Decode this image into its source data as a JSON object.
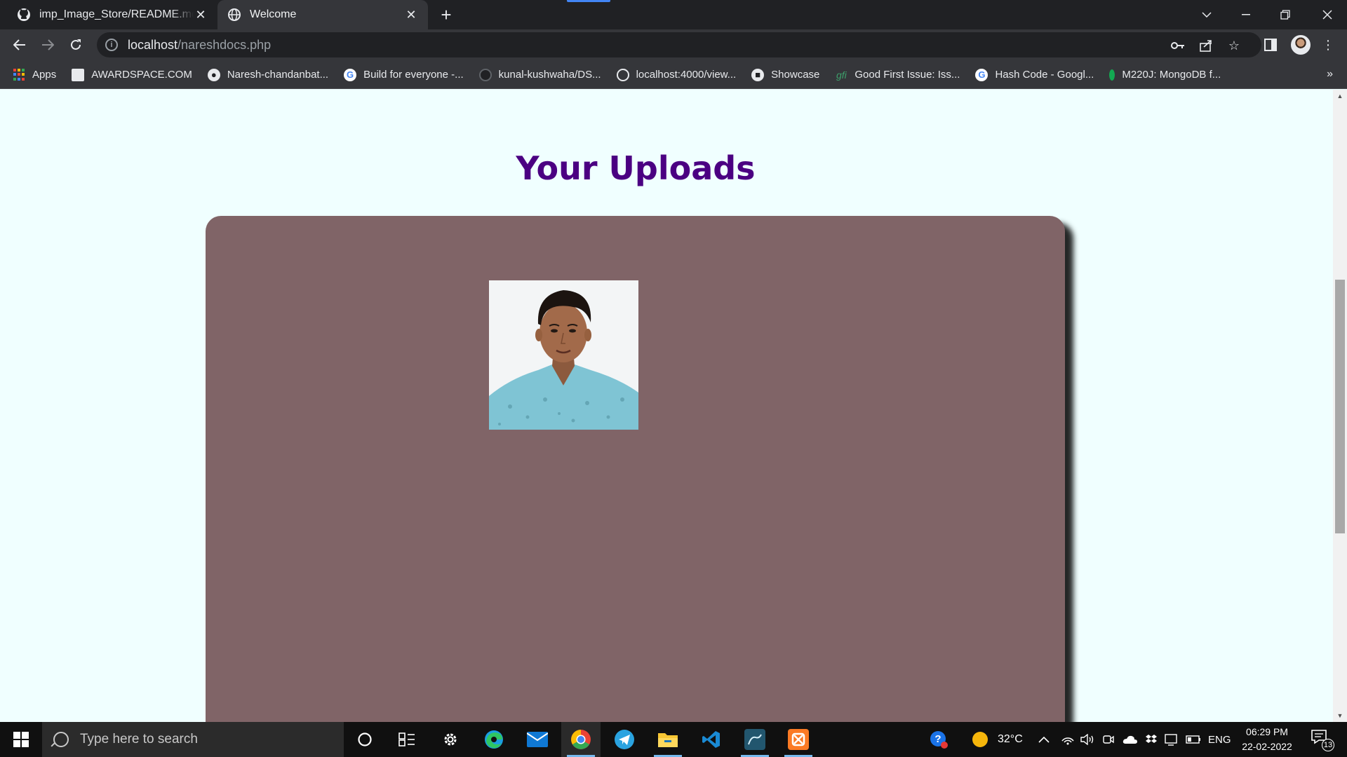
{
  "browser": {
    "tabs": [
      {
        "title": "imp_Image_Store/README.md at ",
        "favicon": "github-icon",
        "active": false
      },
      {
        "title": "Welcome",
        "favicon": "globe-icon",
        "active": true
      }
    ],
    "url_host": "localhost",
    "url_path": "/nareshdocs.php",
    "bookmarks": [
      {
        "label": "Apps",
        "icon": "apps-grid-icon"
      },
      {
        "label": "AWARDSPACE.COM",
        "icon": "awardspace-icon"
      },
      {
        "label": "Naresh-chandanbat...",
        "icon": "github-icon"
      },
      {
        "label": "Build for everyone -...",
        "icon": "google-icon"
      },
      {
        "label": "kunal-kushwaha/DS...",
        "icon": "github-dark-icon"
      },
      {
        "label": "localhost:4000/view...",
        "icon": "globe-icon"
      },
      {
        "label": "Showcase",
        "icon": "showcase-icon"
      },
      {
        "label": "Good First Issue: Iss...",
        "icon": "gfi-icon"
      },
      {
        "label": "Hash Code - Googl...",
        "icon": "google-icon"
      },
      {
        "label": "M220J: MongoDB f...",
        "icon": "mongodb-leaf-icon"
      }
    ],
    "bookmarks_overflow": "»"
  },
  "page": {
    "heading": "Your Uploads",
    "uploads": [
      {
        "type": "image",
        "description": "portrait photo of a young man in a light blue patterned shirt"
      }
    ],
    "colors": {
      "background": "#f0ffff",
      "heading": "#4b0082",
      "panel": "#806467"
    }
  },
  "taskbar": {
    "search_placeholder": "Type here to search",
    "pinned_apps": [
      "cortana-icon",
      "task-view-icon",
      "settings-icon",
      "edge-icon",
      "mail-icon",
      "chrome-icon",
      "telegram-icon",
      "file-explorer-icon",
      "vscode-icon",
      "mysql-workbench-icon",
      "xampp-icon"
    ],
    "temperature": "32°C",
    "language": "ENG",
    "time": "06:29 PM",
    "date": "22-02-2022",
    "notification_count": "13"
  }
}
